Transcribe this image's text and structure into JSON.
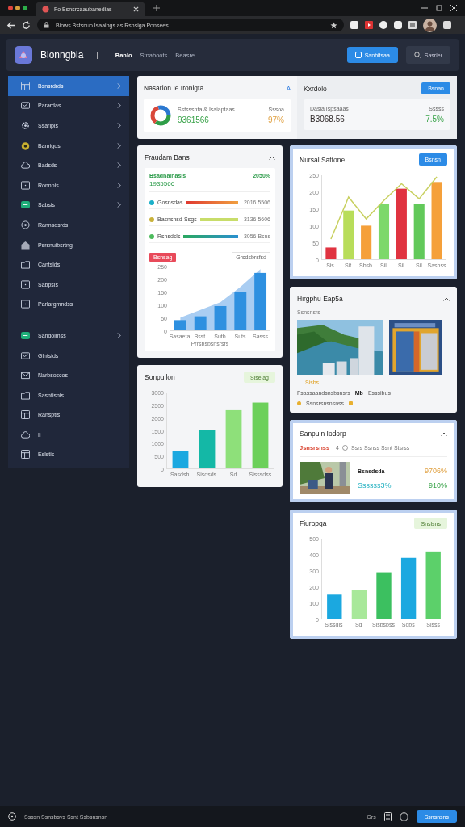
{
  "browser": {
    "tab_title": "Fo Bsnsrcaaubanedias",
    "address": "Biows Bstsnuo Isaaings as Rsnsiga Ponsees"
  },
  "app": {
    "name": "Blonngbia",
    "separator": "|",
    "nav": [
      {
        "label": "Banlo",
        "selected": true
      },
      {
        "label": "Stnaboots",
        "selected": false
      },
      {
        "label": "Beasre",
        "selected": false
      }
    ],
    "primary_button": "Sanbitsaa",
    "secondary_button": "Sasrier"
  },
  "sidebar": {
    "groups": [
      [
        {
          "label": "Bsnsrdrds",
          "selected": true,
          "expandable": true
        },
        {
          "label": "Parardas",
          "selected": false,
          "expandable": true
        },
        {
          "label": "Ssarlpis",
          "selected": false,
          "expandable": true
        },
        {
          "label": "Banrigds",
          "selected": false,
          "expandable": true
        },
        {
          "label": "Badsds",
          "selected": false,
          "expandable": true
        },
        {
          "label": "Ronnpis",
          "selected": false,
          "expandable": true
        },
        {
          "label": "Sabsis",
          "selected": false,
          "expandable": true
        },
        {
          "label": "Rannsdsrds",
          "selected": false,
          "expandable": false
        },
        {
          "label": "Psrsnuibsrtng",
          "selected": false,
          "expandable": false
        },
        {
          "label": "Cantsids",
          "selected": false,
          "expandable": false
        },
        {
          "label": "Sabpsis",
          "selected": false,
          "expandable": false
        },
        {
          "label": "Parlargmndss",
          "selected": false,
          "expandable": false
        }
      ],
      [
        {
          "label": "Sandolmss",
          "selected": false,
          "expandable": true
        },
        {
          "label": "Glntsids",
          "selected": false,
          "expandable": false
        },
        {
          "label": "Narbsoscos",
          "selected": false,
          "expandable": false
        },
        {
          "label": "Sasntisnis",
          "selected": false,
          "expandable": false
        },
        {
          "label": "Ransptls",
          "selected": false,
          "expandable": false
        },
        {
          "label": "Ii",
          "selected": false,
          "expandable": false
        },
        {
          "label": "Eslstis",
          "selected": false,
          "expandable": false
        }
      ]
    ]
  },
  "summary": [
    {
      "title": "Nasarion Ie Ironigta",
      "action": "A",
      "label": "Sstsssnta & Isaiaptaas",
      "value": "9361566",
      "side_label": "Sssoa",
      "side_value": "97%",
      "kind": "donut"
    },
    {
      "title": "Kxrdolo",
      "action": "Bsnan",
      "label": "Dasla Ispsaaas",
      "value": "B3068.56",
      "side_label": "Sssss",
      "side_value": "7.5%",
      "kind": "button"
    }
  ],
  "funds": {
    "title": "Fraudam Bans",
    "stat_label": "Bsadnainasls",
    "stat_value": "1935566",
    "stat_change": "2050%",
    "rows": [
      {
        "label": "Gosnsdas",
        "color": "#1bb0c9",
        "level": 1,
        "reading": "2016 5506"
      },
      {
        "label": "Basnsnsd-Ssgs",
        "color": "#c9b23a",
        "level": 1,
        "reading": "3136 5606"
      },
      {
        "label": "Rsnsdsls",
        "color": "#4cbb5c",
        "level": 1,
        "reading": "3056 Bsns"
      }
    ],
    "badge": "Bsnsag",
    "legend": "Grsdsbrsfsd",
    "chart_data": {
      "type": "bar",
      "xlabel": "Prrsbsbsnsrsrs",
      "categories": [
        "Sasaeta",
        "Bsst",
        "Sutb",
        "Suts",
        "Sasss"
      ],
      "ylim": [
        0,
        250
      ],
      "yticks": [
        0,
        50,
        100,
        150,
        200,
        250
      ],
      "series": [
        {
          "type": "area",
          "color": "#a9cdf2",
          "values": [
            50,
            80,
            110,
            170,
            240
          ]
        },
        {
          "color": "#2e90e0",
          "values": [
            40,
            55,
            95,
            150,
            225
          ]
        }
      ]
    }
  },
  "sonpullon": {
    "title": "Sonpullon",
    "action": "Siseiag",
    "chart_data": {
      "type": "bar",
      "categories": [
        "Sasdsh",
        "Sisdsds",
        "Sd",
        "Sisssdss"
      ],
      "ylim": [
        0,
        3000
      ],
      "yticks": [
        0,
        500,
        1000,
        1500,
        2000,
        2500,
        3000
      ],
      "series": [
        {
          "colors": [
            "#1ba8e0",
            "#14b8a6",
            "#8ee07a",
            "#6cd05a"
          ],
          "values": [
            700,
            1500,
            2300,
            2600
          ]
        }
      ]
    }
  },
  "sattone": {
    "title": "Nursal Sattone",
    "action": "Bsnsn",
    "chart_data": {
      "type": "bar",
      "categories": [
        "Sis",
        "Sit",
        "Sbsb",
        "Sil",
        "Sil",
        "Sil",
        "Sasbss"
      ],
      "ylim": [
        0,
        250
      ],
      "yticks": [
        0,
        50,
        100,
        150,
        200,
        250
      ],
      "series": [
        {
          "colors": [
            "#e03340",
            "#b8dd5a",
            "#f5a03a",
            "#7dd86a",
            "#e03340",
            "#62c95a",
            "#f5a03a"
          ],
          "values": [
            35,
            145,
            100,
            165,
            210,
            165,
            230
          ]
        },
        {
          "type": "line",
          "color": "#c8d060",
          "values": [
            60,
            185,
            120,
            175,
            225,
            180,
            245
          ]
        }
      ]
    }
  },
  "gallery": {
    "title": "Hirgphu Eap5a",
    "subtitle": "Ssnsnsrs",
    "tag": "Sisbs",
    "caption": "Fsassaandsnsbsnsrs",
    "caption_mid": "Mb",
    "caption_end": "Esssibus",
    "footer": "Ssnsrsnsnsnss"
  },
  "report": {
    "title": "Sanpuin Iodorp",
    "highlight": "Jsnsrsnss",
    "count": "4",
    "meta": "Ssrs Ssnss Ssnt Stsrss",
    "name": "Bsnsdsda",
    "value_1": "9706%",
    "value_2": "Ssssss3%",
    "value_3": "910%"
  },
  "fiuropqa": {
    "title": "Fiuropqa",
    "action": "Snslsns",
    "chart_data": {
      "type": "bar",
      "categories": [
        "Sissdis",
        "Sd",
        "Sisbsbss",
        "Sdbs",
        "Sisss"
      ],
      "ylim": [
        0,
        500
      ],
      "yticks": [
        0,
        100,
        200,
        300,
        400,
        500
      ],
      "series": [
        {
          "colors": [
            "#1ba8e0",
            "#a8e89a",
            "#3cc060",
            "#1ba8e0",
            "#5cd06a"
          ],
          "values": [
            150,
            180,
            290,
            380,
            420
          ]
        }
      ]
    }
  },
  "footer": {
    "status": "Ssssn Ssnsbsvs Ssnt Ssbsnsnsn",
    "label": "Grs",
    "button": "Ssnsnsns"
  }
}
